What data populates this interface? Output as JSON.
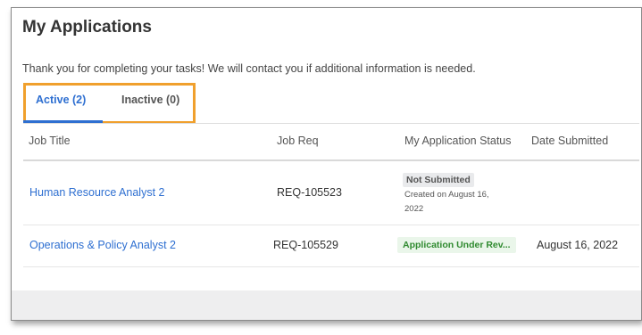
{
  "page": {
    "title": "My Applications",
    "message": "Thank you for completing your tasks! We will contact you if additional information is needed."
  },
  "tabs": [
    {
      "label": "Active (2)",
      "active": true
    },
    {
      "label": "Inactive (0)",
      "active": false
    }
  ],
  "table": {
    "headers": [
      "Job Title",
      "Job Req",
      "My Application Status",
      "Date Submitted"
    ],
    "rows": [
      {
        "job_title": "Human Resource Analyst 2",
        "job_req": "REQ-105523",
        "status": "Not Submitted",
        "status_note": "Created on August 16, 2022",
        "date_submitted": ""
      },
      {
        "job_title": "Operations & Policy Analyst 2",
        "job_req": "REQ-105529",
        "status": "Application Under Rev...",
        "status_note": "",
        "date_submitted": "August 16, 2022"
      }
    ]
  },
  "colors": {
    "accent": "#2e6fd1",
    "highlight": "#f0a02d",
    "status_green": "#2f8a2f"
  }
}
